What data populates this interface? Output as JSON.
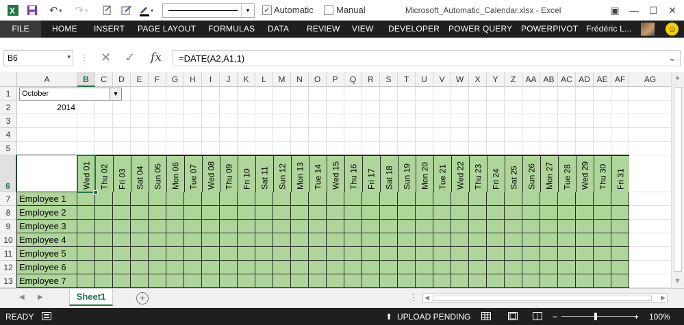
{
  "titlebar": {
    "window_title": "Microsoft_Automatic_Calendar.xlsx - Excel",
    "automatic_label": "Automatic",
    "manual_label": "Manual",
    "automatic_checked": true,
    "manual_checked": false
  },
  "ribbon": {
    "tabs": [
      "FILE",
      "HOME",
      "INSERT",
      "PAGE LAYOUT",
      "FORMULAS",
      "DATA",
      "REVIEW",
      "VIEW",
      "DEVELOPER",
      "POWER QUERY",
      "POWERPIVOT"
    ],
    "user": "Frédéric L..."
  },
  "formula_bar": {
    "name_box": "B6",
    "formula": "=DATE(A2,A1,1)",
    "fx_label": "fx"
  },
  "grid": {
    "columns": [
      "A",
      "B",
      "C",
      "D",
      "E",
      "F",
      "G",
      "H",
      "I",
      "J",
      "K",
      "L",
      "M",
      "N",
      "O",
      "P",
      "Q",
      "R",
      "S",
      "T",
      "U",
      "V",
      "W",
      "X",
      "Y",
      "Z",
      "AA",
      "AB",
      "AC",
      "AD",
      "AE",
      "AF",
      "AG"
    ],
    "rows": [
      "1",
      "2",
      "3",
      "4",
      "5",
      "6",
      "7",
      "8",
      "9",
      "10",
      "11",
      "12",
      "13"
    ],
    "selected_column": "B",
    "selected_row": "6",
    "month_combo": "October",
    "year": "2014",
    "dates": [
      "Wed 01",
      "Thu 02",
      "Fri 03",
      "Sat 04",
      "Sun 05",
      "Mon 06",
      "Tue 07",
      "Wed 08",
      "Thu 09",
      "Fri 10",
      "Sat 11",
      "Sun 12",
      "Mon 13",
      "Tue 14",
      "Wed 15",
      "Thu 16",
      "Fri 17",
      "Sat 18",
      "Sun 19",
      "Mon 20",
      "Tue 21",
      "Wed 22",
      "Thu 23",
      "Fri 24",
      "Sat 25",
      "Sun 26",
      "Mon 27",
      "Tue 28",
      "Wed 29",
      "Thu 30",
      "Fri 31"
    ],
    "employees": [
      "Employee 1",
      "Employee 2",
      "Employee 3",
      "Employee 4",
      "Employee 5",
      "Employee 6",
      "Employee 7"
    ]
  },
  "sheets": {
    "tabs": [
      "Sheet1"
    ],
    "active": "Sheet1"
  },
  "status": {
    "mode": "READY",
    "upload": "UPLOAD PENDING",
    "zoom": "100%",
    "zoom_value": 100
  },
  "colors": {
    "accent": "#217346",
    "cell_fill": "#aed59a",
    "ribbon_bg": "#1f1f1f"
  }
}
